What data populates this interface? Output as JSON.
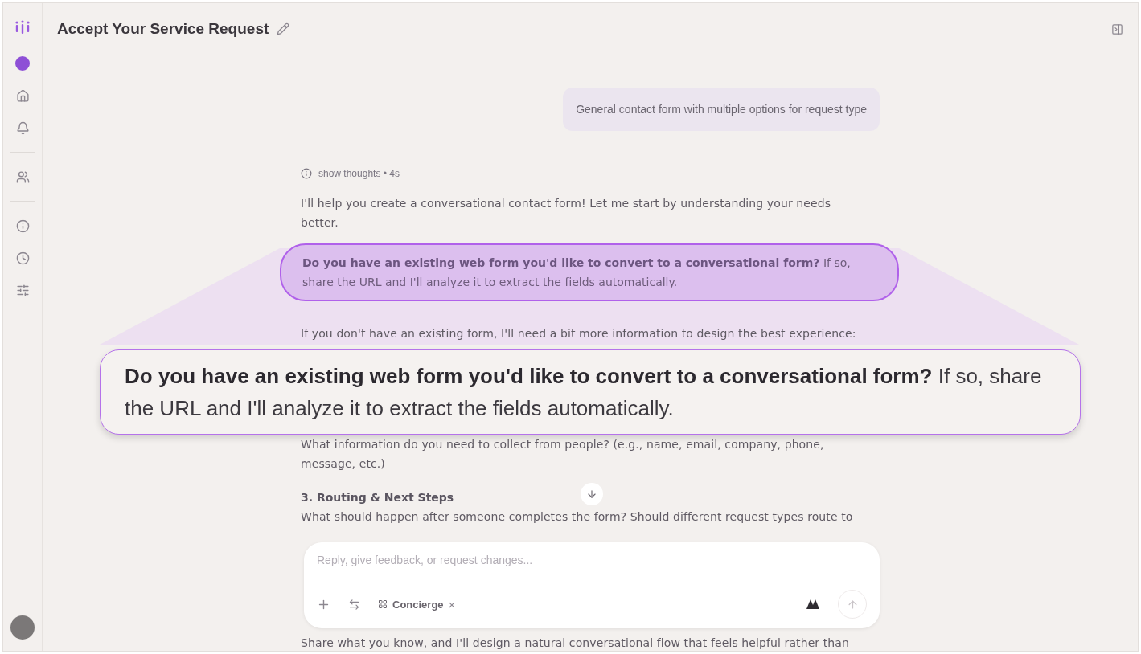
{
  "header": {
    "title": "Accept Your Service Request"
  },
  "messages": [
    {
      "kind": "user",
      "text": "General contact form with multiple options for request type"
    },
    {
      "kind": "thoughts",
      "text": "show thoughts • 4s"
    },
    {
      "kind": "paragraph",
      "text": "I'll help you create a conversational contact form! Let me start by understanding your needs better."
    },
    {
      "kind": "highlight",
      "text": "**Do you have an existing web form you'd like to convert to a conversational form?** If so, share the URL and I'll analyze it to extract the fields automatically."
    },
    {
      "kind": "paragraph",
      "text": "If you don't have an existing form, I'll need a bit more information to design the best experience:"
    },
    {
      "kind": "callout",
      "text": "**Do you have an existing web form you'd like to convert to a conversational form?** If so, share the URL and I'll analyze it to extract the fields automatically."
    },
    {
      "kind": "paragraph",
      "text": "What information do you need to collect from people? (e.g., name, email, company, phone, message, etc.)"
    },
    {
      "kind": "heading",
      "text": "3. Routing & Next Steps"
    },
    {
      "kind": "paragraph",
      "text": "What should happen after someone completes the form? Should different request types route to"
    },
    {
      "kind": "trailing",
      "text": "Share what you know, and I'll design a natural conversational flow that feels helpful rather than"
    }
  ],
  "composer": {
    "placeholder": "Reply, give feedback, or request changes...",
    "chip": "Concierge",
    "chip_close": "×"
  }
}
